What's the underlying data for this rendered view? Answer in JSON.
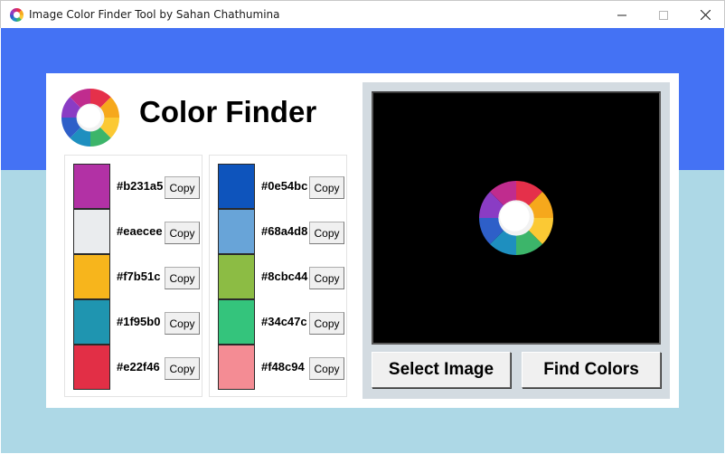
{
  "window": {
    "title": "Image Color Finder Tool by Sahan Chathumina",
    "icon": "color-wheel-icon",
    "controls": [
      "minimize-icon",
      "maximize-icon",
      "close-icon"
    ]
  },
  "theme": {
    "top_band": "#4472f4",
    "bottom_band": "#add8e6",
    "card": "#ffffff",
    "preview_panel": "#d3dbe1"
  },
  "header": {
    "title": "Color Finder",
    "logo": "color-wheel-icon"
  },
  "palette_left": [
    {
      "hex": "#b231a5",
      "copy_label": "Copy"
    },
    {
      "hex": "#eaecee",
      "copy_label": "Copy"
    },
    {
      "hex": "#f7b51c",
      "copy_label": "Copy"
    },
    {
      "hex": "#1f95b0",
      "copy_label": "Copy"
    },
    {
      "hex": "#e22f46",
      "copy_label": "Copy"
    }
  ],
  "palette_right": [
    {
      "hex": "#0e54bc",
      "copy_label": "Copy"
    },
    {
      "hex": "#68a4d8",
      "copy_label": "Copy"
    },
    {
      "hex": "#8cbc44",
      "copy_label": "Copy"
    },
    {
      "hex": "#34c47c",
      "copy_label": "Copy"
    },
    {
      "hex": "#f48c94",
      "copy_label": "Copy"
    }
  ],
  "preview": {
    "background": "#000000",
    "image": "color-wheel-icon"
  },
  "actions": {
    "select_image": "Select Image",
    "find_colors": "Find Colors"
  }
}
